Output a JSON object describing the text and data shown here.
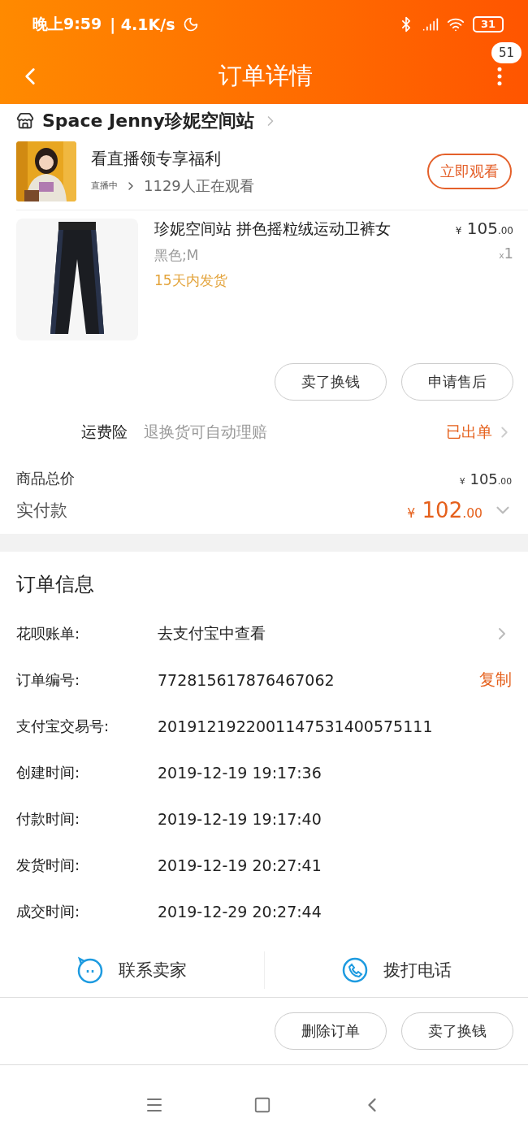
{
  "status_bar": {
    "time": "晚上9:59",
    "speed": "| 4.1K/s",
    "battery": "31"
  },
  "header": {
    "title": "订单详情",
    "badge": "51"
  },
  "store": {
    "name": "Space Jenny珍妮空间站"
  },
  "live": {
    "title": "看直播领专享福利",
    "tag": "直播中",
    "viewers": "1129人正在观看",
    "button": "立即观看"
  },
  "product": {
    "name": "珍妮空间站 拼色摇粒绒运动卫裤女",
    "currency": "¥",
    "price": "105",
    "price_decimal": ".00",
    "variant": "黑色;M",
    "qty_prefix": "x",
    "qty": "1",
    "shipping": "15天内发货"
  },
  "item_buttons": [
    "卖了换钱",
    "申请售后"
  ],
  "insurance": {
    "label": "运费险",
    "note": "退换货可自动理赔",
    "status": "已出单"
  },
  "totals": [
    {
      "kind": "subtotal",
      "label": "商品总价",
      "currency": "¥",
      "amount": "105",
      "decimal": ".00"
    },
    {
      "kind": "paid",
      "label": "实付款",
      "currency": "¥",
      "amount": "102",
      "decimal": ".00"
    }
  ],
  "order_info": {
    "title": "订单信息",
    "rows": [
      {
        "label": "花呗账单:",
        "value": "去支付宝中查看",
        "kind": "link"
      },
      {
        "label": "订单编号:",
        "value": "772815617876467062",
        "action": "复制",
        "kind": "copy"
      },
      {
        "label": "支付宝交易号:",
        "value": "2019121922001147531400575111",
        "kind": "text"
      },
      {
        "label": "创建时间:",
        "value": "2019-12-19 19:17:36",
        "kind": "text"
      },
      {
        "label": "付款时间:",
        "value": "2019-12-19 19:17:40",
        "kind": "text"
      },
      {
        "label": "发货时间:",
        "value": "2019-12-19 20:27:41",
        "kind": "text"
      },
      {
        "label": "成交时间:",
        "value": "2019-12-29 20:27:44",
        "kind": "text"
      }
    ]
  },
  "contact": [
    {
      "kind": "chat",
      "label": "联系卖家"
    },
    {
      "kind": "phone",
      "label": "拨打电话"
    }
  ],
  "footer_buttons": [
    "删除订单",
    "卖了换钱"
  ]
}
